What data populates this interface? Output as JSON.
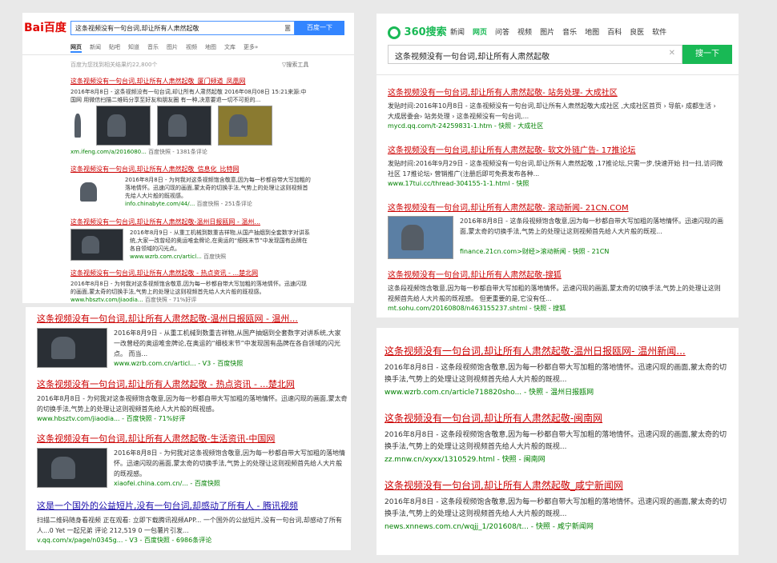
{
  "query": "这条视频没有一句台词,却让所有人肃然起敬",
  "baidu": {
    "logo": "Bai百度",
    "search_button": "百度一下",
    "tabs": [
      "网页",
      "新闻",
      "贴吧",
      "知道",
      "音乐",
      "图片",
      "视频",
      "地图",
      "文库",
      "更多»"
    ],
    "count": "百度为您找到相关结果约22,800个",
    "tool": "搜索工具",
    "results": [
      {
        "title": "这条视频没有一句台词,却让所有人肃然起敬_厦门频道_凤凰网",
        "snippet": "2016年8月8日 - 这条视频没有一句台词,却让所有人肃然起敬 2016年08月08日 15:21来源:中国网 用微信扫描二维码分享至好友和朋友圈 有一种,决意要退一切不可拒的...",
        "url": "xm.ifeng.com/a/2016080...",
        "meta": "百度快照 - 1381条评论"
      },
      {
        "title": "这条视频没有一句台词,却让所有人肃然起敬_信息化_比特网",
        "snippet": "2016年8月8日 - 为何我对这条视频饱含敬意,因为每一秒都自带大写加粗的落地情怀。迅速闪现的画面,蒙太奇的切换手法,气势上的处理让这则视频首先给人大片般的既视感。",
        "url": "info.chinabyte.com/44/...",
        "meta": "百度快照 - 251条评论"
      },
      {
        "title": "这条视频没有一句台词,却让所有人肃然起敬-温州日报瓯网 - 温州...",
        "snippet": "2016年8月9日 - 从重工机械到数重吉祥物,从国产抽烟到全套数字对讲系统,大家一改曾经的奥运唯金牌论,在奥运的“细枝末节”中发现国有品牌在各自领域的闪光点。",
        "url": "www.wzrb.com.cn/articl...",
        "meta": "百度快照"
      },
      {
        "title": "这条视频没有一句台词,却让所有人肃然起敬 - 热点资讯 - ...楚北网",
        "snippet": "2016年8月8日 - 为何我对这条视频饱含敬意,因为每一秒都自带大写加粗的落地情怀。迅速闪现的画面,蒙太奇的切换手法,气势上的处理让这则视频首先给人大片般的既视感。",
        "url": "www.hbsztv.com/jiaodia...",
        "meta": "百度快照 - 71%好评"
      }
    ]
  },
  "so360": {
    "logo": "360搜索",
    "nav": [
      "新闻",
      "网页",
      "问答",
      "视频",
      "图片",
      "音乐",
      "地图",
      "百科",
      "良医",
      "软件"
    ],
    "search_button": "搜一下",
    "clear_glyph": "✕",
    "results": [
      {
        "title": "这条视频没有一句台词,却让所有人肃然起敬- 站务处理- 大成社区",
        "snippet": "发贴时间:2016年10月8日 - 这条视频没有一句台词,却让所有人肃然起敬大成社区 ,大成社区首页 › 导航› 成都生活 › 大成居委会› 站务处理 › 这条视频没有一句台词,...",
        "meta": "mycd.qq.com/t-24259831-1.htm - 快照 - 大成社区"
      },
      {
        "title": "这条视频没有一句台词,却让所有人肃然起敬- 软文外链广告- 17推论坛",
        "snippet": "发贴时间:2016年9月29日 - 这条视频没有一句台词,却让所有人肃然起敬 ,17推论坛,只需一步,快速开始 扫一扫,访问微社区 17推论坛› 营销推广(注册后即可免费发布各种...",
        "meta": "www.17tui.cc/thread-304155-1-1.html - 快照"
      },
      {
        "title": "这条视频没有一句台词,却让所有人肃然起敬- 滚动新闻- 21CN.COM",
        "snippet": "2016年8月8日 - 这条段视频饱含敬意,因为每一秒都自带大写加粗的落地情怀。迅速闪现的画面,蒙太奇的切换手法,气势上的处理让这则视频首先给人大片般的既视...",
        "meta": "finance.21cn.com>财经>滚动新闻 - 快照 - 21CN"
      },
      {
        "title": "这条视频没有一句台词,却让所有人肃然起敬-搜狐",
        "snippet": "这条段视频饱含敬意,因为每一秒都自带大写加粗的落地情怀。迅速闪现的画面,蒙太奇的切换手法,气势上的处理让这则视频首先给人大片般的既视感。 但更重要的是,它没有任...",
        "meta": "mt.sohu.com/20160808/n463155237.shtml - 快照 - 搜狐"
      }
    ]
  },
  "baidu_zoom": {
    "results": [
      {
        "title": "这条视频没有一句台词,却让所有人肃然起敬-温州日报瓯网 - 温州...",
        "snippet": "2016年8月9日 - 从重工机械到数重吉祥物,从国产抽烟到全套数字对讲系统,大家一改曾经的奥运唯金牌论,在奥运的“细枝末节”中发现国有品牌在各自领域的闪光点。 而当...",
        "meta": "www.wzrb.com.cn/articl... - V3 - 百度快照"
      },
      {
        "title": "这条视频没有一句台词,却让所有人肃然起敬 - 热点资讯 - ...楚北网",
        "snippet": "2016年8月8日 - 为何我对这条视频饱含敬意,因为每一秒都自带大写加粗的落地情怀。迅速闪现的画面,蒙太奇的切换手法,气势上的处理让这则视频首先给人大片般的既视感。",
        "meta": "www.hbsztv.com/jiaodia... - 百度快照 - 71%好评"
      },
      {
        "title": "这条视频没有一句台词,却让所有人肃然起敬-生活资讯-中国网",
        "snippet": "2016年8月8日 - 为何我对这条视频饱含敬意,因为每一秒都自带大写加粗的落地情怀。迅速闪现的画面,蒙太奇的切换手法,气势上的处理让这则视频首先给人大片般的既视感。",
        "meta": "xiaofei.china.com.cn/... - 百度快照"
      },
      {
        "title": "这是一个国外的公益短片,没有一句台词,却感动了所有人 - 腾讯视频",
        "snippet": "扫描二维码随身看视频 正在观看: 立即下载腾讯视频APP... 一个国外的公益短片,没有一句台词,却感动了所有人...0 Yet 一起兄弟 评论 212,519 0 一包薯片引发...",
        "meta": "v.qq.com/x/page/n0345g... - V3 - 百度快照 - 6986条评论"
      }
    ]
  },
  "so360_zoom": {
    "results": [
      {
        "title": "这条视频没有一句台词,却让所有人肃然起敬-温州日报瓯网- 温州新闻...",
        "snippet": "2016年8月8日 - 这条段视频饱含敬意,因为每一秒都自带大写加粗的落地情怀。迅速闪现的画面,蒙太奇的切换手法,气势上的处理让这则视频首先给人大片般的既视...",
        "meta": "www.wzrb.com.cn/article718820sho... - 快照 - 温州日报瓯网"
      },
      {
        "title": "这条视频没有一句台词,却让所有人肃然起敬-闽南网",
        "snippet": "2016年8月8日 - 这条段视频饱含敬意,因为每一秒都自带大写加粗的落地情怀。迅速闪现的画面,蒙太奇的切换手法,气势上的处理让这则视频首先给人大片般的既视...",
        "meta": "zz.mnw.cn/xyxx/1310529.html - 快照 - 闽南网"
      },
      {
        "title": "这条视频没有一句台词,却让所有人肃然起敬_咸宁新闻网",
        "snippet": "2016年8月8日 - 这条段视频饱含敬意,因为每一秒都自带大写加粗的落地情怀。迅速闪现的画面,蒙太奇的切换手法,气势上的处理让这则视频首先给人大片般的既视...",
        "meta": "news.xnnews.com.cn/wqjj_1/201608/t... - 快照 - 咸宁新闻网"
      }
    ]
  }
}
